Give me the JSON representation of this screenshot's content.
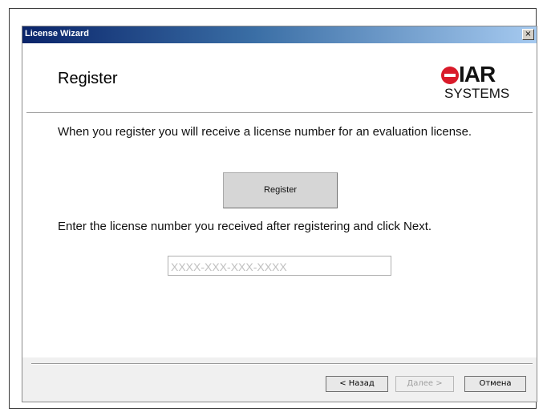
{
  "window": {
    "title": "License Wizard",
    "close_symbol": "×"
  },
  "header": {
    "title": "Register",
    "logo": {
      "brand": "IAR",
      "subtitle": "SYSTEMS",
      "color": "#d91a2a"
    }
  },
  "body": {
    "intro_text": "When you register you will receive a license number for an evaluation license.",
    "register_button": "Register",
    "instruction_text": "Enter the license number you received after registering and click Next.",
    "license_input": {
      "value": "",
      "placeholder": "XXXX-XXX-XXX-XXXX"
    }
  },
  "footer": {
    "back_button": "< Назад",
    "next_button": "Далее >",
    "cancel_button": "Отмена"
  },
  "colors": {
    "titlebar_start": "#0a246a",
    "titlebar_end": "#a6caf0",
    "disabled_text": "#a0a0a0"
  }
}
